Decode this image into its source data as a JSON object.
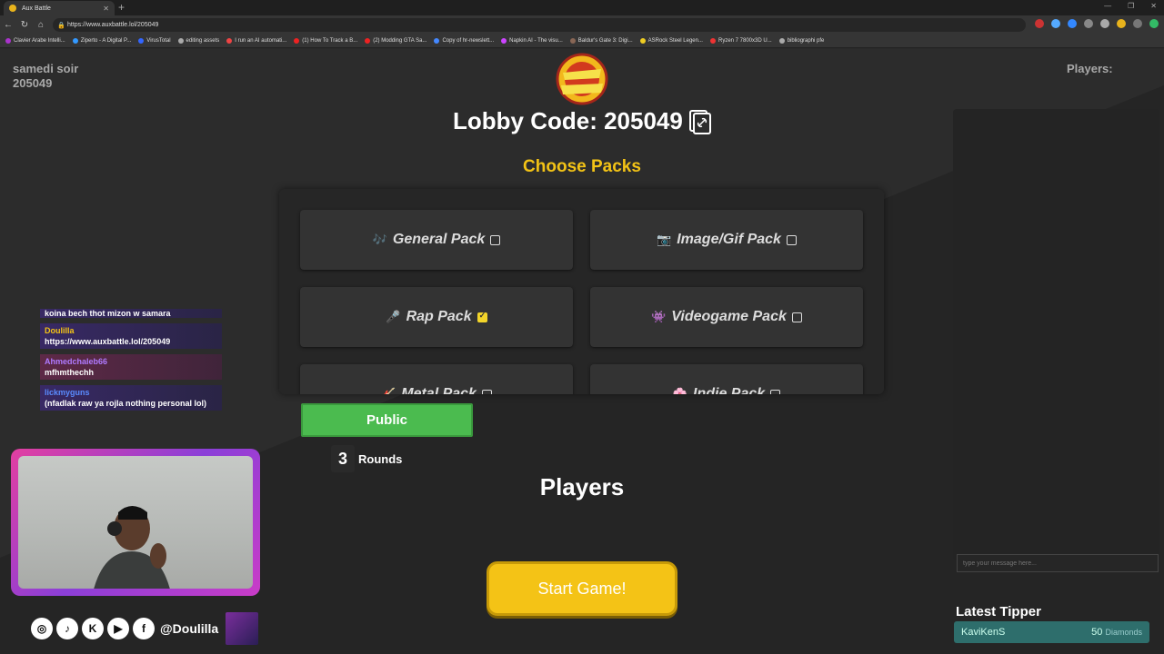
{
  "browser": {
    "tab_title": "Aux Battle",
    "url": "https://www.auxbattle.lol/205049",
    "bookmarks": [
      "Clavier Arabe Intelli...",
      "Ziperto - A Digital P...",
      "VirusTotal",
      "editing assets",
      "I run an AI automati...",
      "(1) How To Track a B...",
      "(2) Modding GTA Sa...",
      "Copy of hr-newslett...",
      "Napkin AI - The visu...",
      "Baldur's Gate 3: Digi...",
      "ASRock Steel Legen...",
      "Ryzen 7 7800x3D U...",
      "bibliographi pfe"
    ]
  },
  "lobby": {
    "name_line1": "samedi soir",
    "name_line2": "205049",
    "players_label": "Players:",
    "code_label": "Lobby Code: 205049",
    "choose_packs": "Choose Packs"
  },
  "packs": [
    {
      "label": "General Pack",
      "emoji": "🎶",
      "checked": false
    },
    {
      "label": "Image/Gif Pack",
      "emoji": "📷",
      "checked": false
    },
    {
      "label": "Rap Pack",
      "emoji": "🎤",
      "checked": true
    },
    {
      "label": "Videogame Pack",
      "emoji": "👾",
      "checked": false
    },
    {
      "label": "Metal Pack",
      "emoji": "🎸",
      "checked": false
    },
    {
      "label": "Indie Pack",
      "emoji": "🌸",
      "checked": false
    }
  ],
  "controls": {
    "visibility": "Public",
    "rounds_value": "3",
    "rounds_label": "Rounds",
    "players_heading": "Players",
    "start_button": "Start Game!"
  },
  "chat": {
    "placeholder": "type your message here..."
  },
  "tipper": {
    "heading": "Latest Tipper",
    "name": "KaviKenS",
    "amount": "50",
    "unit": "Diamonds"
  },
  "stream_chat": [
    {
      "user": "",
      "text": "koina bech thot mizon w samara"
    },
    {
      "user": "Doulilla",
      "text": "https://www.auxbattle.lol/205049"
    },
    {
      "user": "Ahmedchaleb66",
      "text": "mfhmthechh"
    },
    {
      "user": "lickmyguns",
      "text": "(nfadlak raw ya rojla nothing personal lol)"
    }
  ],
  "overlay": {
    "handle": "@Doulilla"
  },
  "colors": {
    "accent_yellow": "#f3c316",
    "public_green": "#4bbb4f",
    "tipper_teal": "#2e6e6c"
  }
}
